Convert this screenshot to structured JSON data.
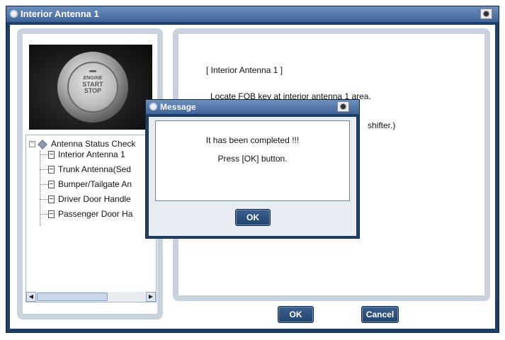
{
  "window": {
    "title": "Interior Antenna 1"
  },
  "photo": {
    "label_engine": "ENGINE",
    "label_start": "START",
    "label_stop": "STOP"
  },
  "tree": {
    "root": "Antenna Status Check",
    "items": [
      {
        "label": "Interior Antenna 1"
      },
      {
        "label": "Trunk Antenna(Sed"
      },
      {
        "label": "Bumper/Tailgate An"
      },
      {
        "label": "Driver Door Handle"
      },
      {
        "label": "Passenger Door Ha"
      }
    ]
  },
  "info": {
    "title": "[ Interior Antenna 1 ]",
    "line1": "Locate FOB key at interior antenna 1 area.",
    "line2": "shifter.)"
  },
  "buttons": {
    "ok": "OK",
    "cancel": "Cancel"
  },
  "message": {
    "title": "Message",
    "line1": "It has been completed !!!",
    "line2": "Press [OK] button.",
    "ok": "OK"
  },
  "icons": {
    "title": "globe-icon",
    "camera": "camera-icon",
    "tree_root": "diamond-icon",
    "tree_item": "document-icon",
    "scroll_left": "arrow-left-icon",
    "scroll_right": "arrow-right-icon"
  },
  "colors": {
    "frame": "#1e3f66",
    "title_gradient_top": "#6d8fbd",
    "button": "#23466f"
  }
}
